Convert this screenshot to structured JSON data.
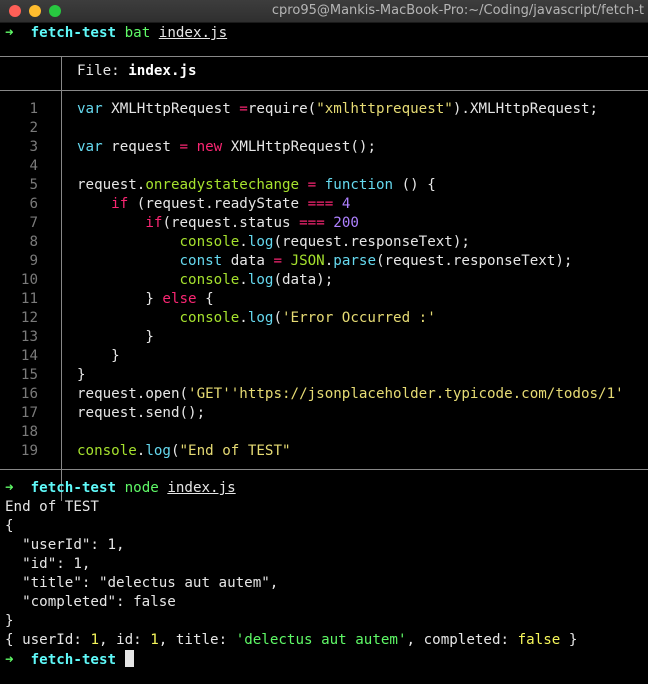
{
  "window": {
    "title": "cpro95@Mankis-MacBook-Pro:~/Coding/javascript/fetch-t"
  },
  "prompt": {
    "arrow": "➜",
    "dir": "fetch-test"
  },
  "cmd1": {
    "name": "bat",
    "arg": "index.js"
  },
  "header": {
    "label": "File: ",
    "file": "index.js"
  },
  "code_lines": [
    {
      "n": "1",
      "t": [
        [
          "k",
          "var"
        ],
        [
          "",
          "XMLHttpRequest "
        ],
        [
          "op",
          "="
        ],
        [
          "",
          "require("
        ],
        [
          "str",
          "\"xmlhttprequest\""
        ],
        [
          "",
          ").XMLHttpRequest;"
        ]
      ]
    },
    {
      "n": "2",
      "t": []
    },
    {
      "n": "3",
      "t": [
        [
          "k",
          "var"
        ],
        [
          "",
          "request "
        ],
        [
          "op",
          "="
        ],
        [
          "op",
          " new"
        ],
        [
          "",
          " XMLHttpRequest();"
        ]
      ]
    },
    {
      "n": "4",
      "t": []
    },
    {
      "n": "5",
      "t": [
        [
          "",
          "request."
        ],
        [
          "fn",
          "onreadystatechange"
        ],
        [
          "",
          " "
        ],
        [
          "op",
          "="
        ],
        [
          "",
          " "
        ],
        [
          "k",
          "function"
        ],
        [
          "",
          " () {"
        ]
      ]
    },
    {
      "n": "6",
      "t": [
        [
          "",
          "    "
        ],
        [
          "op",
          "if"
        ],
        [
          "",
          " (request.readyState "
        ],
        [
          "op",
          "==="
        ],
        [
          "",
          " "
        ],
        [
          "num",
          "4"
        ],
        [
          ") {"
        ]
      ]
    },
    {
      "n": "7",
      "t": [
        [
          "",
          "        "
        ],
        [
          "op",
          "if"
        ],
        [
          "",
          "(request.status "
        ],
        [
          "op",
          "==="
        ],
        [
          "",
          " "
        ],
        [
          "num",
          "200"
        ],
        [
          ") {"
        ]
      ]
    },
    {
      "n": "8",
      "t": [
        [
          "",
          "            "
        ],
        [
          "fn",
          "console"
        ],
        [
          "",
          "."
        ],
        [
          "k",
          "log"
        ],
        [
          "",
          "(request.responseText);"
        ]
      ]
    },
    {
      "n": "9",
      "t": [
        [
          "",
          "            "
        ],
        [
          "k",
          "const"
        ],
        [
          "",
          " data "
        ],
        [
          "op",
          "="
        ],
        [
          "",
          " "
        ],
        [
          "fn",
          "JSON"
        ],
        [
          "",
          "."
        ],
        [
          "k",
          "parse"
        ],
        [
          "",
          "(request.responseText);"
        ]
      ]
    },
    {
      "n": "10",
      "t": [
        [
          "",
          "            "
        ],
        [
          "fn",
          "console"
        ],
        [
          "",
          "."
        ],
        [
          "k",
          "log"
        ],
        [
          "",
          "(data);"
        ]
      ]
    },
    {
      "n": "11",
      "t": [
        [
          "",
          "        } "
        ],
        [
          "op",
          "else"
        ],
        [
          "",
          " {"
        ]
      ]
    },
    {
      "n": "12",
      "t": [
        [
          "",
          "            "
        ],
        [
          "fn",
          "console"
        ],
        [
          "",
          "."
        ],
        [
          "k",
          "log"
        ],
        [
          "",
          "("
        ],
        [
          "str",
          "'Error Occurred :'"
        ],
        [
          ");"
        ]
      ]
    },
    {
      "n": "13",
      "t": [
        [
          "",
          "        }"
        ]
      ]
    },
    {
      "n": "14",
      "t": [
        [
          "",
          "    }"
        ]
      ]
    },
    {
      "n": "15",
      "t": [
        [
          "",
          "}"
        ]
      ]
    },
    {
      "n": "16",
      "t": [
        [
          "",
          "request.open("
        ],
        [
          "str",
          "'GET'"
        ],
        [
          ", "
        ],
        [
          "str",
          "'https://jsonplaceholder.typicode.com/todos/1'"
        ],
        [
          ");"
        ]
      ]
    },
    {
      "n": "17",
      "t": [
        [
          "",
          "request.send();"
        ]
      ]
    },
    {
      "n": "18",
      "t": []
    },
    {
      "n": "19",
      "t": [
        [
          "fn",
          "console"
        ],
        [
          "",
          "."
        ],
        [
          "k",
          "log"
        ],
        [
          "",
          "("
        ],
        [
          "str",
          "\"End of TEST\""
        ],
        [
          ");"
        ]
      ]
    }
  ],
  "cmd2": {
    "name": "node",
    "arg": "index.js"
  },
  "output": [
    "End of TEST",
    "{",
    "  \"userId\": 1,",
    "  \"id\": 1,",
    "  \"title\": \"delectus aut autem\",",
    "  \"completed\": false",
    "}"
  ],
  "inspect": {
    "open": "{ ",
    "k1": "userId:",
    "v1": "1",
    "k2": "id:",
    "v2": "1",
    "k3": "title:",
    "v3": "'delectus aut autem'",
    "k4": "completed:",
    "v4": "false",
    "close": " }"
  }
}
